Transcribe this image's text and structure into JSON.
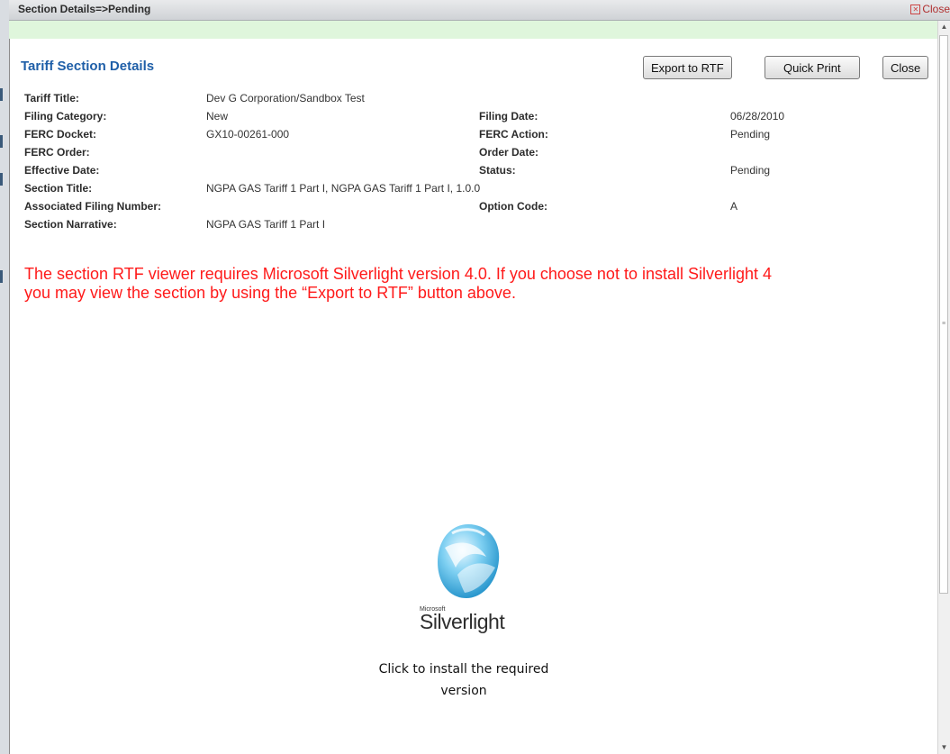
{
  "window": {
    "title": "Section Details=>Pending",
    "close_label": "Close"
  },
  "header": {
    "heading": "Tariff Section Details",
    "buttons": {
      "export": "Export to RTF",
      "print": "Quick Print",
      "close": "Close"
    }
  },
  "details": {
    "tariff_title_label": "Tariff Title:",
    "tariff_title_value": "Dev G Corporation/Sandbox Test",
    "filing_category_label": "Filing Category:",
    "filing_category_value": "New",
    "filing_date_label": "Filing Date:",
    "filing_date_value": "06/28/2010",
    "ferc_docket_label": "FERC Docket:",
    "ferc_docket_value": "GX10-00261-000",
    "ferc_action_label": "FERC Action:",
    "ferc_action_value": "Pending",
    "ferc_order_label": "FERC Order:",
    "order_date_label": "Order Date:",
    "effective_date_label": "Effective Date:",
    "status_label": "Status:",
    "status_value": "Pending",
    "section_title_label": "Section Title:",
    "section_title_value": "NGPA GAS Tariff 1 Part I, NGPA GAS Tariff 1 Part I, 1.0.0",
    "assoc_filing_label": "Associated Filing Number:",
    "option_code_label": "Option Code:",
    "option_code_value": "A",
    "section_narrative_label": "Section Narrative:",
    "section_narrative_value": "NGPA GAS Tariff 1 Part I"
  },
  "notice": {
    "line1": "The section RTF viewer requires Microsoft Silverlight version 4.0. If you choose not to install Silverlight 4",
    "line2": "you may view the section by using the “Export to RTF” button above."
  },
  "silverlight": {
    "microsoft": "Microsoft",
    "product": "Silverlight",
    "cta_line1": "Click to install the required",
    "cta_line2": "version"
  },
  "colors": {
    "heading": "#1f5fa8",
    "notice": "#ff1a1a",
    "band": "#dff6dc"
  }
}
